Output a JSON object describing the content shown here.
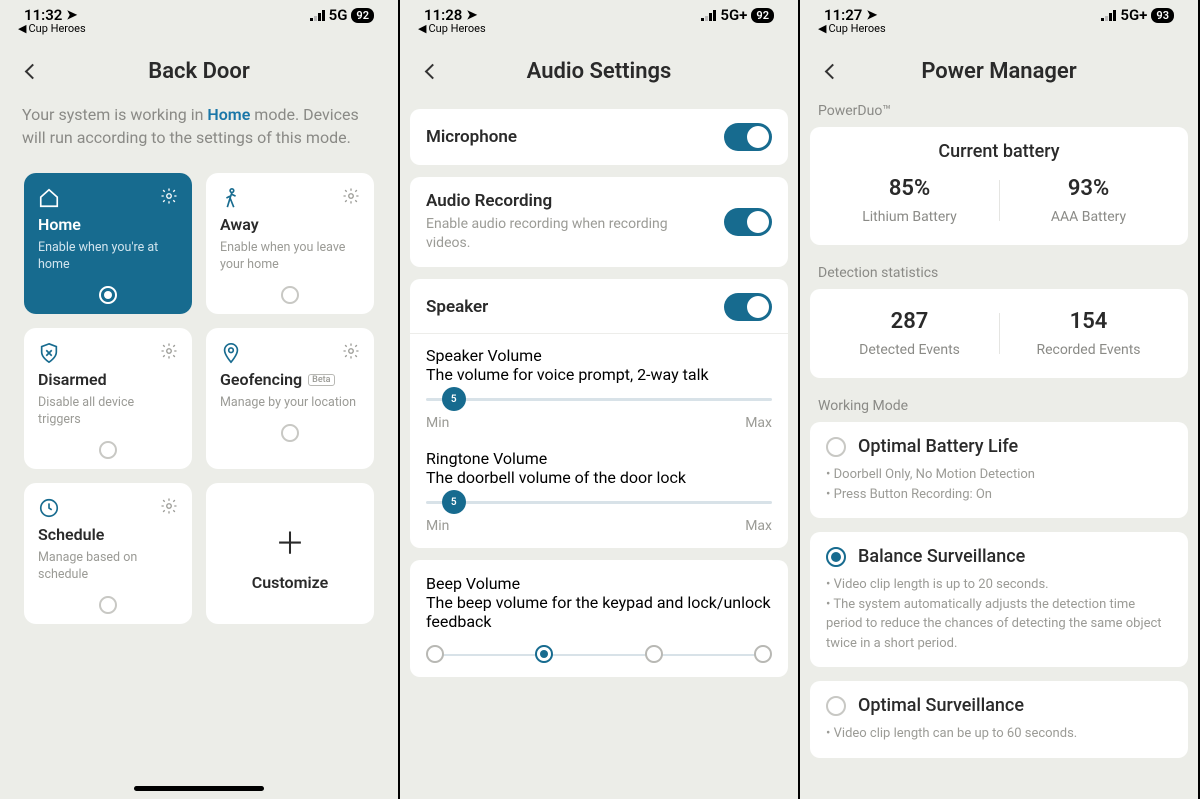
{
  "screen1": {
    "status": {
      "time": "11:32",
      "back_app": "Cup Heroes",
      "network": "5G",
      "battery": "92"
    },
    "title": "Back Door",
    "subtitle_pre": "Your system is working in ",
    "subtitle_link": "Home",
    "subtitle_post": " mode. Devices will run according to the settings of this mode.",
    "modes": {
      "home": {
        "label": "Home",
        "desc": "Enable when you're at home"
      },
      "away": {
        "label": "Away",
        "desc": "Enable when you leave your home"
      },
      "disarmed": {
        "label": "Disarmed",
        "desc": "Disable all device triggers"
      },
      "geofencing": {
        "label": "Geofencing",
        "desc": "Manage by your location",
        "badge": "Beta"
      },
      "schedule": {
        "label": "Schedule",
        "desc": "Manage based on schedule"
      },
      "customize": {
        "label": "Customize"
      }
    }
  },
  "screen2": {
    "status": {
      "time": "11:28",
      "back_app": "Cup Heroes",
      "network": "5G+",
      "battery": "92"
    },
    "title": "Audio Settings",
    "microphone": {
      "label": "Microphone"
    },
    "recording": {
      "label": "Audio Recording",
      "desc": "Enable audio recording when recording videos."
    },
    "speaker": {
      "label": "Speaker"
    },
    "speaker_vol": {
      "label": "Speaker Volume",
      "desc": "The volume for voice prompt, 2-way talk",
      "value": "5",
      "min": "Min",
      "max": "Max"
    },
    "ringtone_vol": {
      "label": "Ringtone Volume",
      "desc": "The doorbell volume of the door lock",
      "value": "5",
      "min": "Min",
      "max": "Max"
    },
    "beep_vol": {
      "label": "Beep Volume",
      "desc": "The beep volume for the keypad and lock/unlock feedback"
    }
  },
  "screen3": {
    "status": {
      "time": "11:27",
      "back_app": "Cup Heroes",
      "network": "5G+",
      "battery": "93"
    },
    "title": "Power Manager",
    "powerduo": "PowerDuo™",
    "battery_card": {
      "title": "Current battery",
      "lithium_val": "85%",
      "lithium_lab": "Lithium Battery",
      "aaa_val": "93%",
      "aaa_lab": "AAA Battery"
    },
    "detection_label": "Detection statistics",
    "detection_card": {
      "detected_val": "287",
      "detected_lab": "Detected Events",
      "recorded_val": "154",
      "recorded_lab": "Recorded Events"
    },
    "working_mode_label": "Working Mode",
    "wm_optimal_battery": {
      "title": "Optimal Battery Life",
      "line1": "Doorbell Only, No Motion Detection",
      "line2": "Press Button Recording: On"
    },
    "wm_balance": {
      "title": "Balance Surveillance",
      "line1": "Video clip length is up to 20 seconds.",
      "line2": "The system automatically adjusts the detection time period to reduce the chances of detecting the same object twice in a short period."
    },
    "wm_optimal_surv": {
      "title": "Optimal Surveillance",
      "line1": "Video clip length can be up to 60 seconds."
    }
  }
}
